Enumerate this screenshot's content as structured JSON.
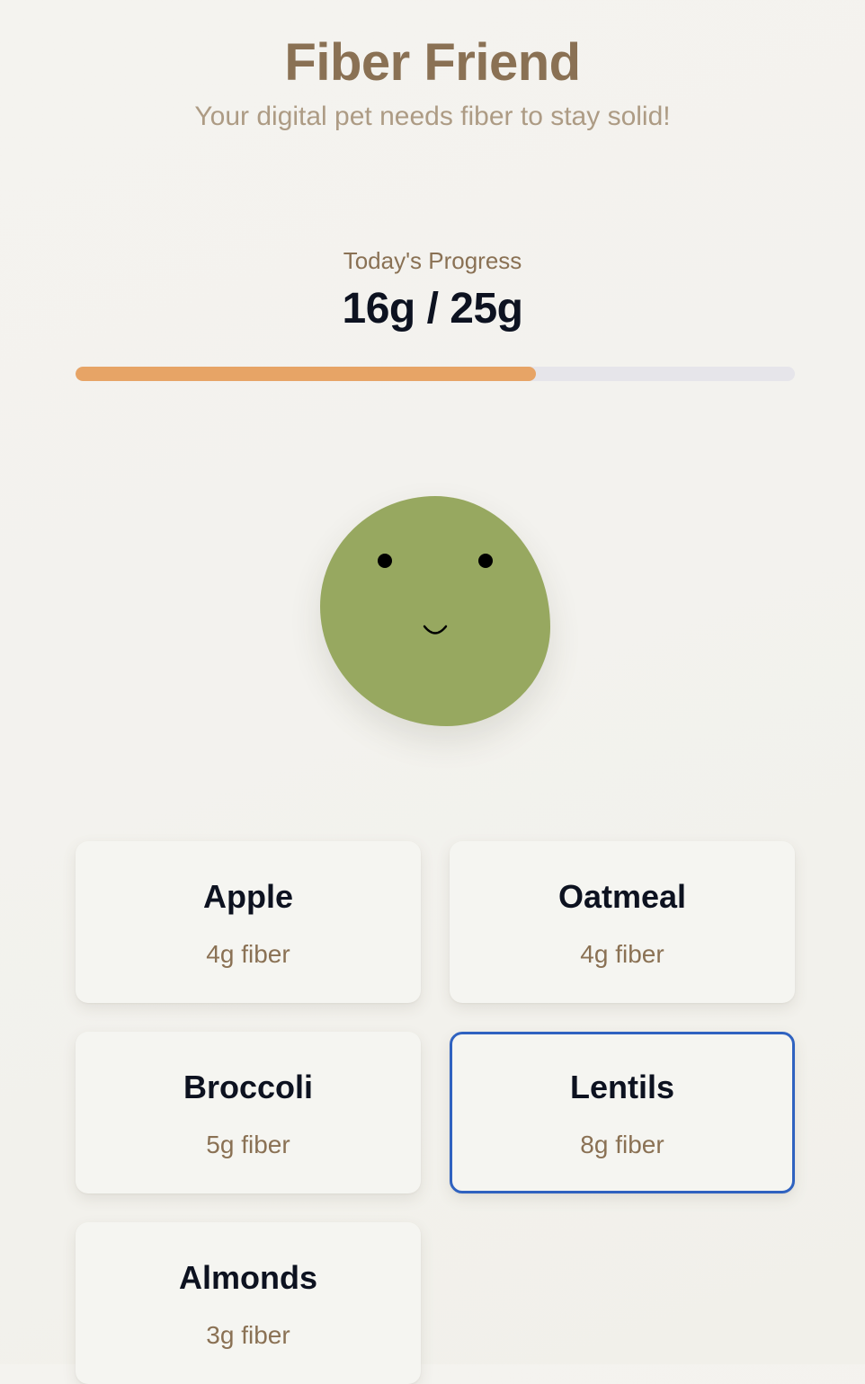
{
  "header": {
    "title": "Fiber Friend",
    "subtitle": "Your digital pet needs fiber to stay solid!"
  },
  "progress": {
    "label": "Today's Progress",
    "value_text": "16g / 25g",
    "current_g": 16,
    "goal_g": 25,
    "fill_fraction": 0.64,
    "fill_color": "#e7a466",
    "track_color": "#e6e5ea"
  },
  "pet": {
    "color": "#97a860",
    "expression": "smile"
  },
  "foods": [
    {
      "name": "Apple",
      "fiber": "4g fiber",
      "selected": false
    },
    {
      "name": "Oatmeal",
      "fiber": "4g fiber",
      "selected": false
    },
    {
      "name": "Broccoli",
      "fiber": "5g fiber",
      "selected": false
    },
    {
      "name": "Lentils",
      "fiber": "8g fiber",
      "selected": true
    },
    {
      "name": "Almonds",
      "fiber": "3g fiber",
      "selected": false
    }
  ],
  "colors": {
    "title": "#8a7154",
    "selected_border": "#2f62c0"
  }
}
